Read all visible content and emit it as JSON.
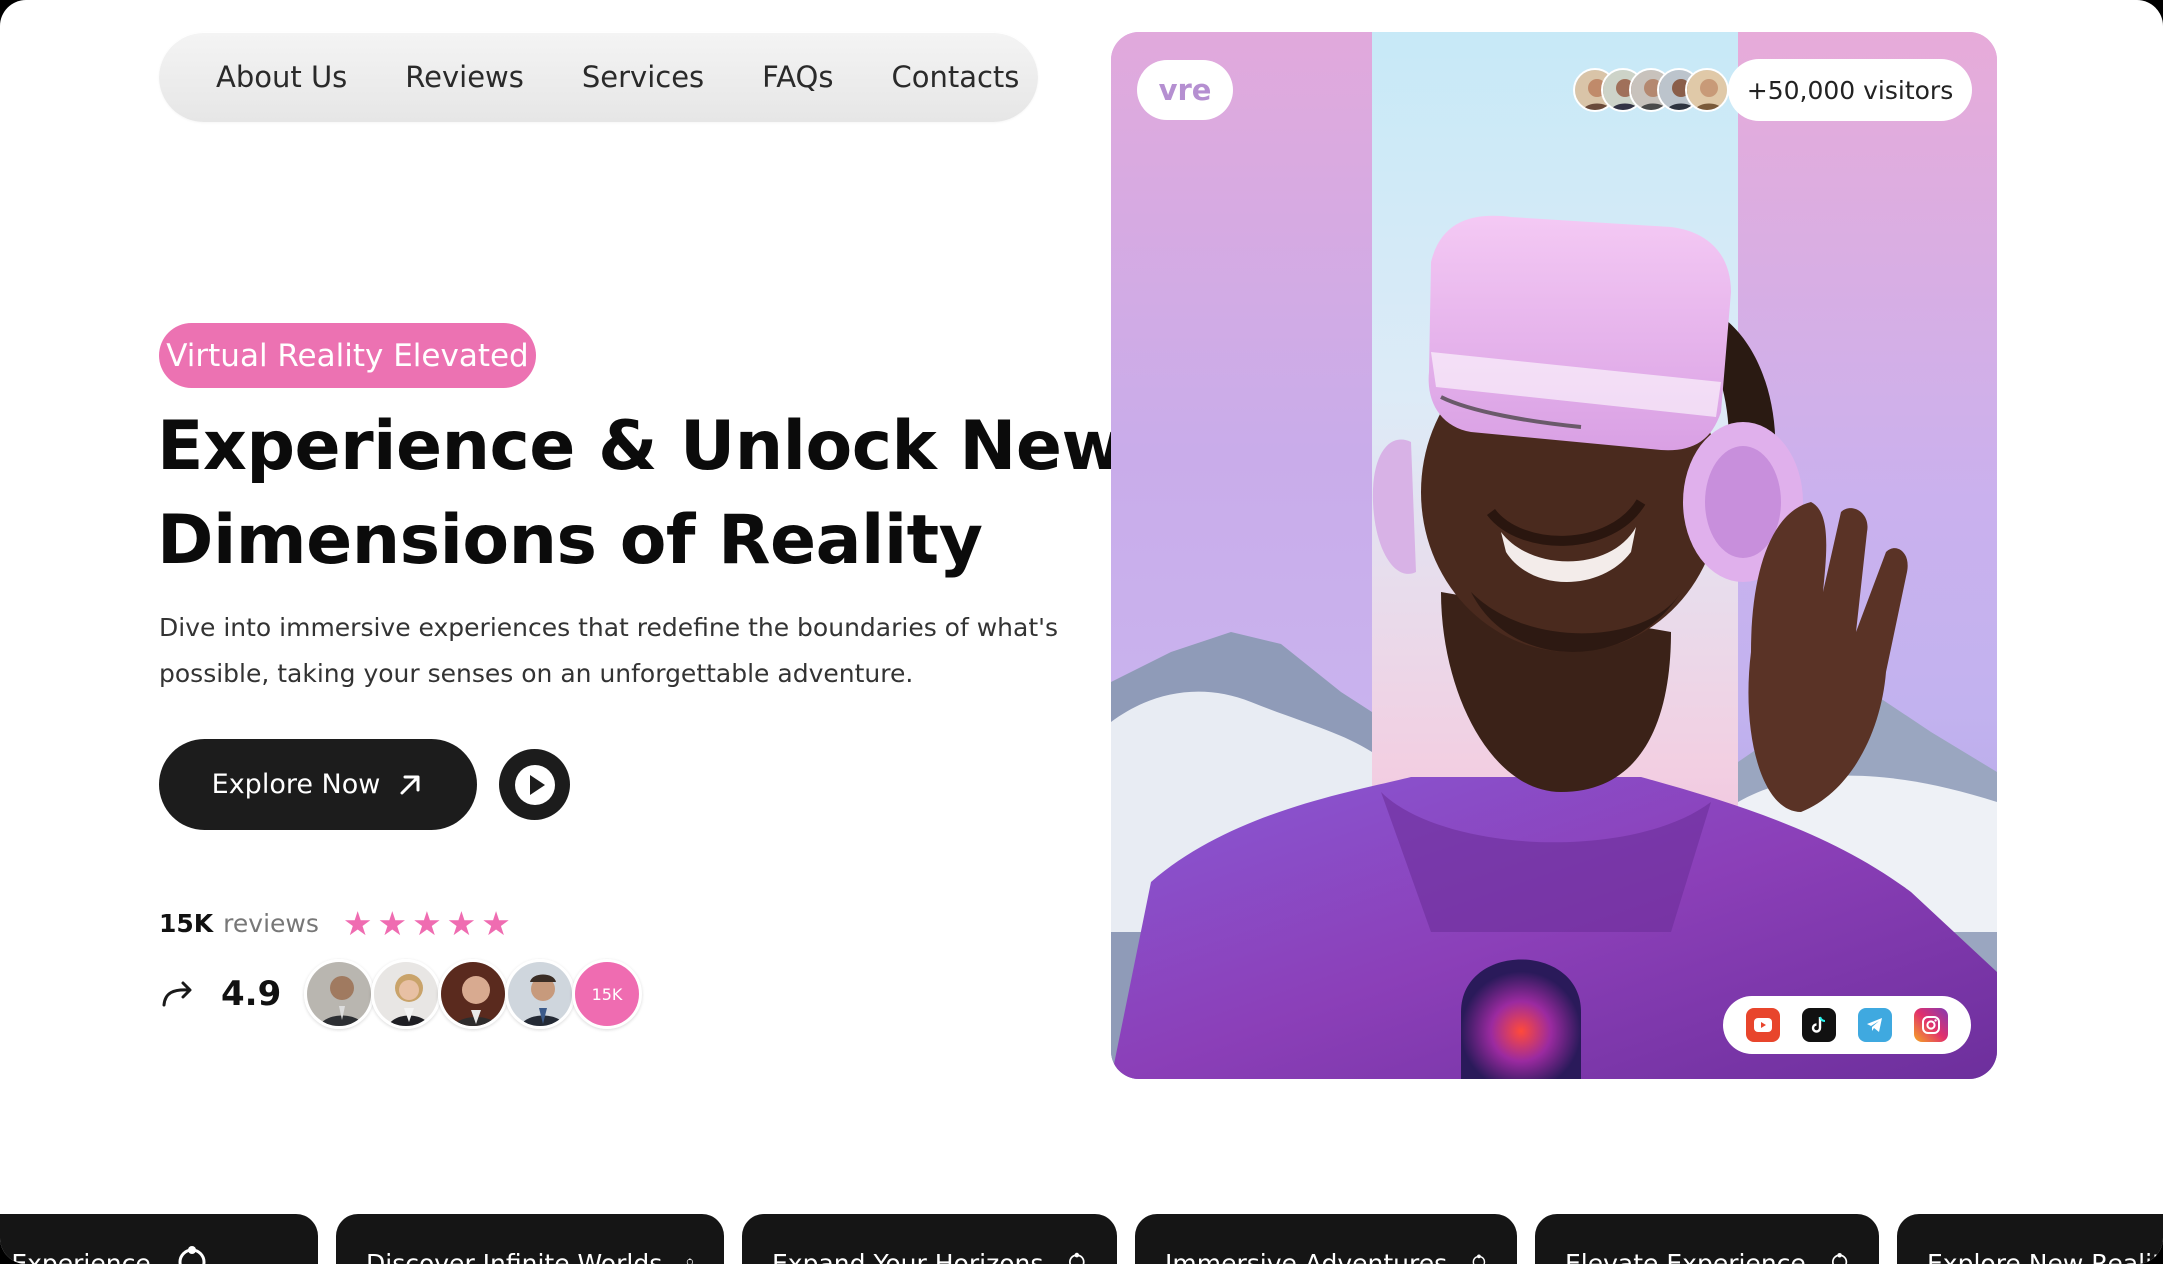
{
  "nav": {
    "items": [
      "About Us",
      "Reviews",
      "Services",
      "FAQs",
      "Contacts"
    ]
  },
  "hero": {
    "tagline": "Virtual Reality Elevated",
    "headline_line1": "Experience & Unlock New",
    "headline_line2": "Dimensions of Reality",
    "description_line1": "Dive into immersive experiences that redefine the boundaries of what's",
    "description_line2": "possible, taking your senses on an unforgettable adventure.",
    "cta_label": "Explore Now",
    "cta_icon": "arrow-up-right-icon",
    "play_icon": "play-icon"
  },
  "reviews": {
    "count": "15K",
    "word": "reviews",
    "stars": 5,
    "rating": "4.9",
    "more_label": "15K"
  },
  "card": {
    "brand": "vre",
    "visitors": "+50,000 visitors",
    "socials": [
      "youtube-icon",
      "tiktok-icon",
      "telegram-icon",
      "instagram-icon"
    ]
  },
  "ticker": {
    "items": [
      "Your Experience",
      "Discover Infinite Worlds",
      "Expand Your Horizons",
      "Immersive Adventures",
      "Elevate Experience",
      "Explore New Realities"
    ]
  },
  "colors": {
    "accent_pink": "#ec72b2",
    "dark": "#1c1c1c",
    "youtube": "#e8452c",
    "tiktok": "#111111",
    "telegram": "#3fa9e0",
    "instagram": "#c13bb4"
  }
}
